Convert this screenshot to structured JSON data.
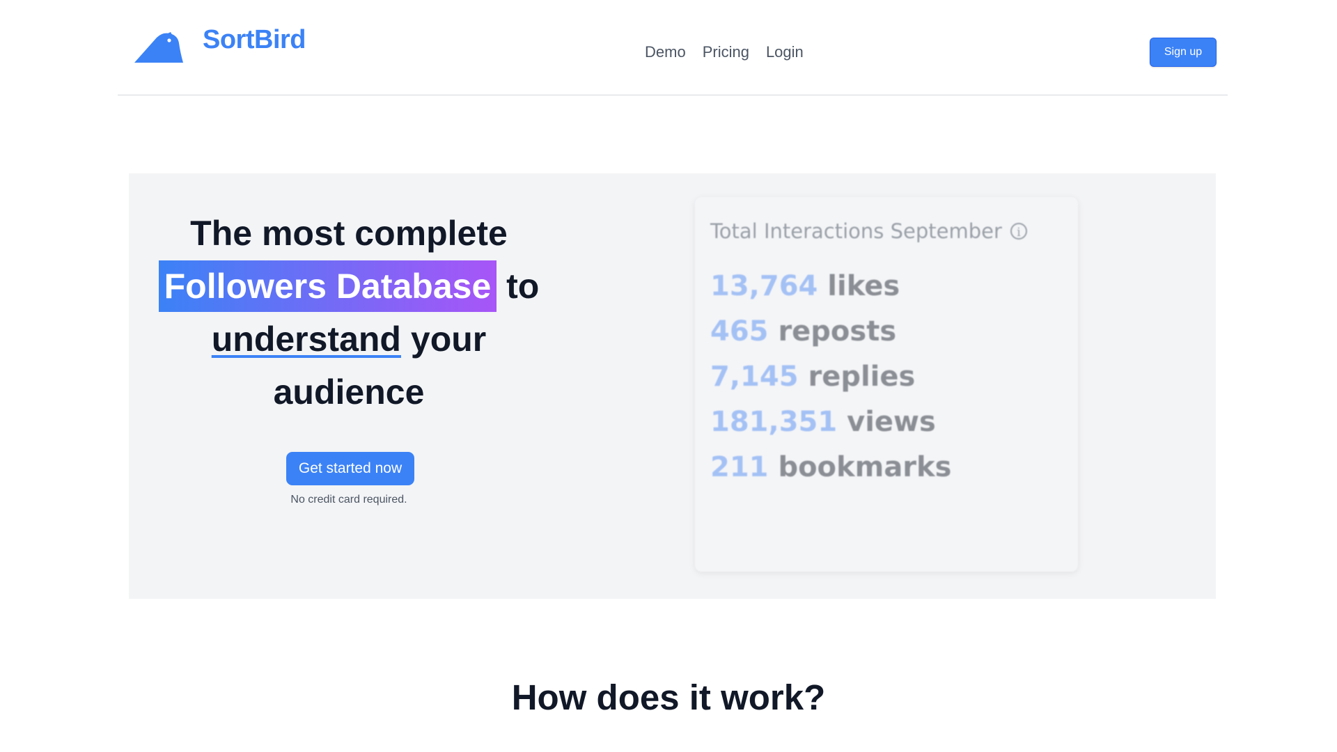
{
  "brand": {
    "name": "SortBird",
    "logo_icon": "bird-logo-icon",
    "color": "#3b82f6"
  },
  "nav": {
    "items": [
      {
        "label": "Demo"
      },
      {
        "label": "Pricing"
      },
      {
        "label": "Login"
      }
    ],
    "signup_label": "Sign up"
  },
  "hero": {
    "headline_line1": "The most complete",
    "highlight": "Followers Database",
    "after_highlight": "to",
    "underlined": "understand",
    "after_underlined": "your",
    "headline_line4": "audience",
    "cta_label": "Get started now",
    "cta_note": "No credit card required.",
    "highlight_gradient": [
      "#3b82f6",
      "#a855f7"
    ]
  },
  "stats_card": {
    "title": "Total Interactions September",
    "info_icon": "info-icon",
    "items": [
      {
        "value": "13,764",
        "label": "likes"
      },
      {
        "value": "465",
        "label": "reposts"
      },
      {
        "value": "7,145",
        "label": "replies"
      },
      {
        "value": "181,351",
        "label": "views"
      },
      {
        "value": "211",
        "label": "bookmarks"
      }
    ]
  },
  "section": {
    "title": "How does it work?"
  }
}
